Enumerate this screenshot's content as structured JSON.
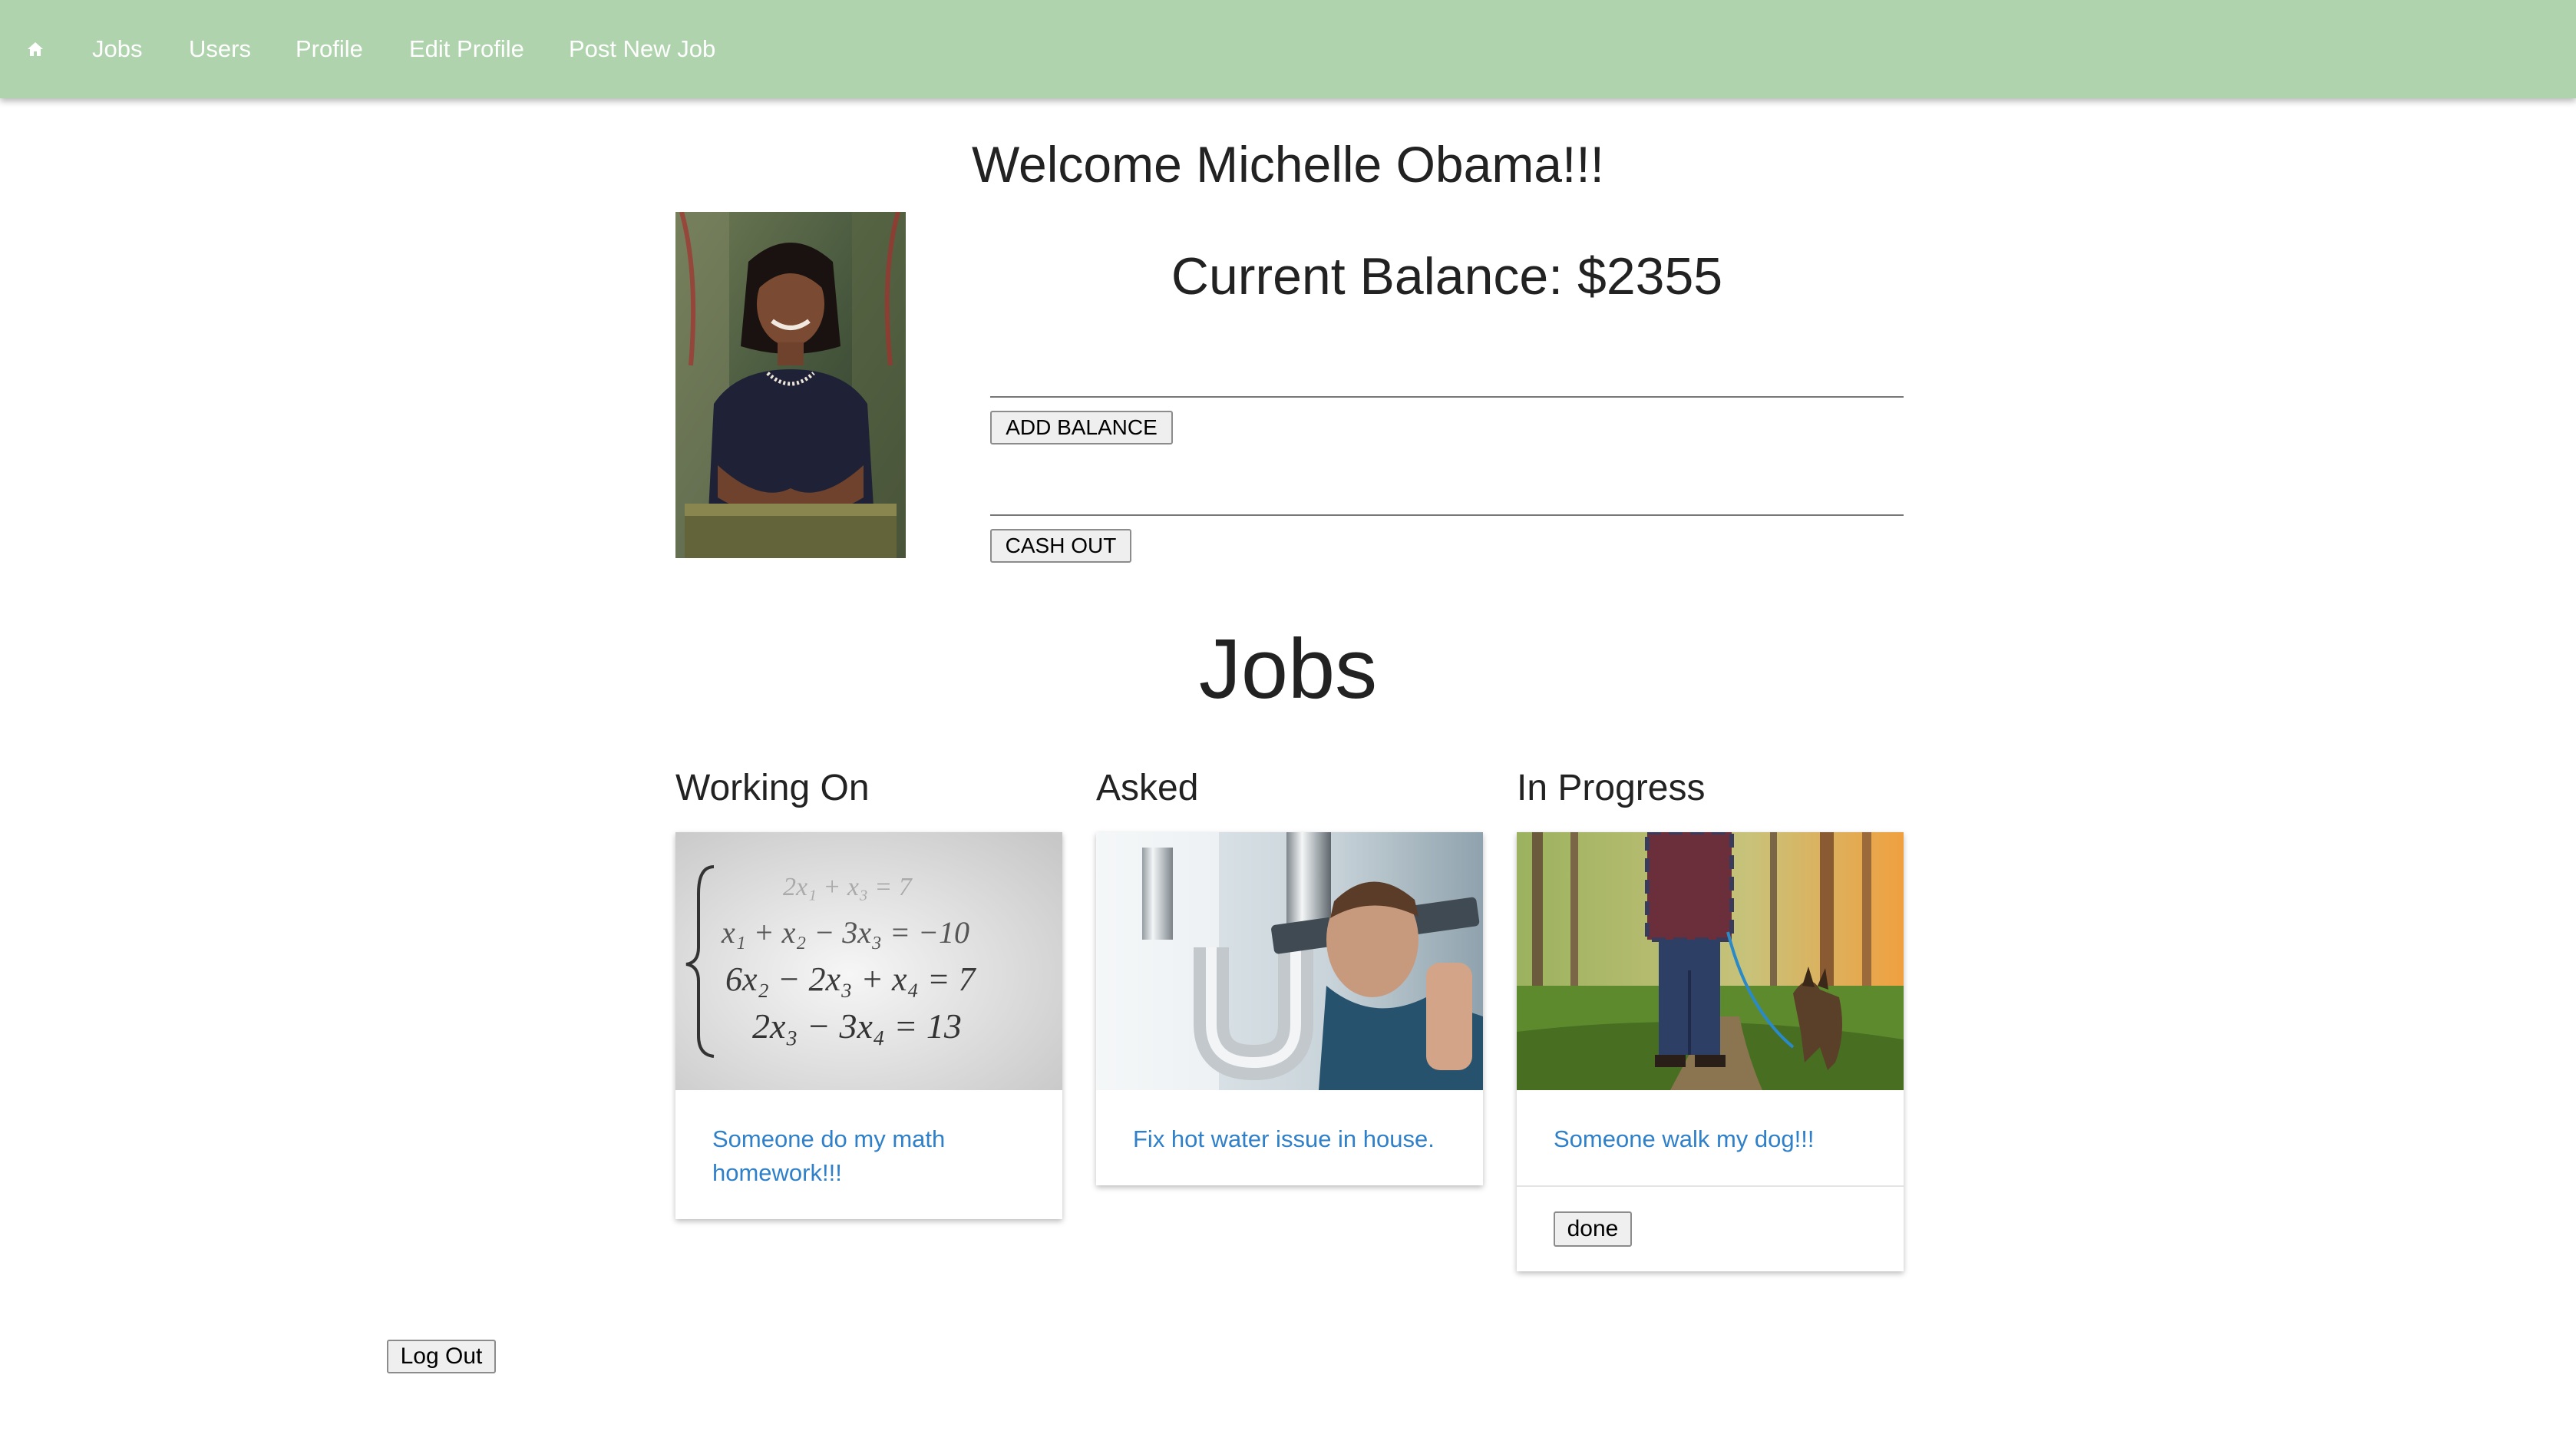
{
  "nav": {
    "home_icon": "home-icon",
    "links": [
      "Jobs",
      "Users",
      "Profile",
      "Edit Profile",
      "Post New Job"
    ]
  },
  "profile": {
    "welcome": "Welcome Michelle Obama!!!",
    "balance_text": "Current Balance: $2355",
    "add_balance_input": {
      "value": "",
      "placeholder": ""
    },
    "add_balance_label": "ADD BALANCE",
    "cash_out_input": {
      "value": "",
      "placeholder": ""
    },
    "cash_out_label": "CASH OUT"
  },
  "jobs": {
    "heading": "Jobs",
    "columns": [
      {
        "heading": "Working On",
        "card_title": "Someone do my math homework!!!"
      },
      {
        "heading": "Asked",
        "card_title": "Fix hot water issue in house."
      },
      {
        "heading": "In Progress",
        "card_title": "Someone walk my dog!!!",
        "action_label": "done"
      }
    ],
    "math_image_lines": [
      "2x₁ + x₃ = 7",
      "x₁ + x₂ − 3x₃ = −10",
      "6x₂ − 2x₃ + x₄ = 7",
      "2x₃ − 3x₄ = 13"
    ]
  },
  "footer": {
    "logout_label": "Log Out"
  },
  "colors": {
    "nav_background": "#afd4ad",
    "link_blue": "#2f80c9"
  }
}
